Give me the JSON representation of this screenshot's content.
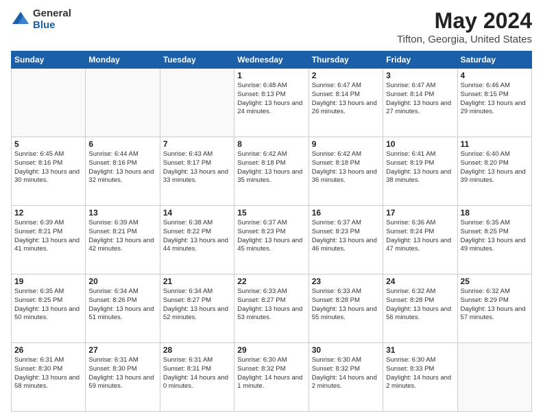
{
  "logo": {
    "general": "General",
    "blue": "Blue"
  },
  "title": "May 2024",
  "subtitle": "Tifton, Georgia, United States",
  "days_of_week": [
    "Sunday",
    "Monday",
    "Tuesday",
    "Wednesday",
    "Thursday",
    "Friday",
    "Saturday"
  ],
  "weeks": [
    [
      {
        "day": "",
        "info": ""
      },
      {
        "day": "",
        "info": ""
      },
      {
        "day": "",
        "info": ""
      },
      {
        "day": "1",
        "info": "Sunrise: 6:48 AM\nSunset: 8:13 PM\nDaylight: 13 hours\nand 24 minutes."
      },
      {
        "day": "2",
        "info": "Sunrise: 6:47 AM\nSunset: 8:14 PM\nDaylight: 13 hours\nand 26 minutes."
      },
      {
        "day": "3",
        "info": "Sunrise: 6:47 AM\nSunset: 8:14 PM\nDaylight: 13 hours\nand 27 minutes."
      },
      {
        "day": "4",
        "info": "Sunrise: 6:46 AM\nSunset: 8:15 PM\nDaylight: 13 hours\nand 29 minutes."
      }
    ],
    [
      {
        "day": "5",
        "info": "Sunrise: 6:45 AM\nSunset: 8:16 PM\nDaylight: 13 hours\nand 30 minutes."
      },
      {
        "day": "6",
        "info": "Sunrise: 6:44 AM\nSunset: 8:16 PM\nDaylight: 13 hours\nand 32 minutes."
      },
      {
        "day": "7",
        "info": "Sunrise: 6:43 AM\nSunset: 8:17 PM\nDaylight: 13 hours\nand 33 minutes."
      },
      {
        "day": "8",
        "info": "Sunrise: 6:42 AM\nSunset: 8:18 PM\nDaylight: 13 hours\nand 35 minutes."
      },
      {
        "day": "9",
        "info": "Sunrise: 6:42 AM\nSunset: 8:18 PM\nDaylight: 13 hours\nand 36 minutes."
      },
      {
        "day": "10",
        "info": "Sunrise: 6:41 AM\nSunset: 8:19 PM\nDaylight: 13 hours\nand 38 minutes."
      },
      {
        "day": "11",
        "info": "Sunrise: 6:40 AM\nSunset: 8:20 PM\nDaylight: 13 hours\nand 39 minutes."
      }
    ],
    [
      {
        "day": "12",
        "info": "Sunrise: 6:39 AM\nSunset: 8:21 PM\nDaylight: 13 hours\nand 41 minutes."
      },
      {
        "day": "13",
        "info": "Sunrise: 6:39 AM\nSunset: 8:21 PM\nDaylight: 13 hours\nand 42 minutes."
      },
      {
        "day": "14",
        "info": "Sunrise: 6:38 AM\nSunset: 8:22 PM\nDaylight: 13 hours\nand 44 minutes."
      },
      {
        "day": "15",
        "info": "Sunrise: 6:37 AM\nSunset: 8:23 PM\nDaylight: 13 hours\nand 45 minutes."
      },
      {
        "day": "16",
        "info": "Sunrise: 6:37 AM\nSunset: 8:23 PM\nDaylight: 13 hours\nand 46 minutes."
      },
      {
        "day": "17",
        "info": "Sunrise: 6:36 AM\nSunset: 8:24 PM\nDaylight: 13 hours\nand 47 minutes."
      },
      {
        "day": "18",
        "info": "Sunrise: 6:35 AM\nSunset: 8:25 PM\nDaylight: 13 hours\nand 49 minutes."
      }
    ],
    [
      {
        "day": "19",
        "info": "Sunrise: 6:35 AM\nSunset: 8:25 PM\nDaylight: 13 hours\nand 50 minutes."
      },
      {
        "day": "20",
        "info": "Sunrise: 6:34 AM\nSunset: 8:26 PM\nDaylight: 13 hours\nand 51 minutes."
      },
      {
        "day": "21",
        "info": "Sunrise: 6:34 AM\nSunset: 8:27 PM\nDaylight: 13 hours\nand 52 minutes."
      },
      {
        "day": "22",
        "info": "Sunrise: 6:33 AM\nSunset: 8:27 PM\nDaylight: 13 hours\nand 53 minutes."
      },
      {
        "day": "23",
        "info": "Sunrise: 6:33 AM\nSunset: 8:28 PM\nDaylight: 13 hours\nand 55 minutes."
      },
      {
        "day": "24",
        "info": "Sunrise: 6:32 AM\nSunset: 8:28 PM\nDaylight: 13 hours\nand 56 minutes."
      },
      {
        "day": "25",
        "info": "Sunrise: 6:32 AM\nSunset: 8:29 PM\nDaylight: 13 hours\nand 57 minutes."
      }
    ],
    [
      {
        "day": "26",
        "info": "Sunrise: 6:31 AM\nSunset: 8:30 PM\nDaylight: 13 hours\nand 58 minutes."
      },
      {
        "day": "27",
        "info": "Sunrise: 6:31 AM\nSunset: 8:30 PM\nDaylight: 13 hours\nand 59 minutes."
      },
      {
        "day": "28",
        "info": "Sunrise: 6:31 AM\nSunset: 8:31 PM\nDaylight: 14 hours\nand 0 minutes."
      },
      {
        "day": "29",
        "info": "Sunrise: 6:30 AM\nSunset: 8:32 PM\nDaylight: 14 hours\nand 1 minute."
      },
      {
        "day": "30",
        "info": "Sunrise: 6:30 AM\nSunset: 8:32 PM\nDaylight: 14 hours\nand 2 minutes."
      },
      {
        "day": "31",
        "info": "Sunrise: 6:30 AM\nSunset: 8:33 PM\nDaylight: 14 hours\nand 2 minutes."
      },
      {
        "day": "",
        "info": ""
      }
    ]
  ]
}
